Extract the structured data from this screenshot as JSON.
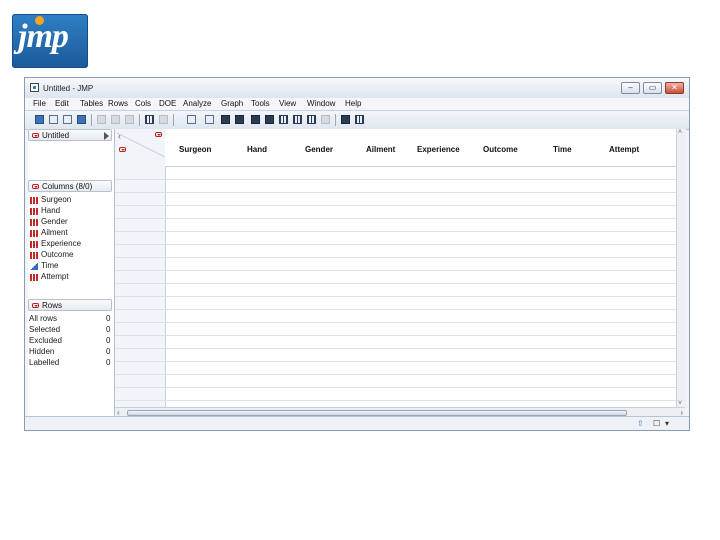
{
  "logo": {
    "text": "jmp"
  },
  "window": {
    "title": "Untitled - JMP",
    "buttons": {
      "minimize": "–",
      "maximize": "▭",
      "close": "✕"
    }
  },
  "menu": [
    "File",
    "Edit",
    "Tables",
    "Rows",
    "Cols",
    "DOE",
    "Analyze",
    "Graph",
    "Tools",
    "View",
    "Window",
    "Help"
  ],
  "table_panel": {
    "name": "Untitled"
  },
  "columns_panel": {
    "header": "Columns (8/0)",
    "items": [
      {
        "label": "Surgeon",
        "icon": "nominal-icon"
      },
      {
        "label": "Hand",
        "icon": "nominal-icon"
      },
      {
        "label": "Gender",
        "icon": "nominal-icon"
      },
      {
        "label": "Ailment",
        "icon": "nominal-icon"
      },
      {
        "label": "Experience",
        "icon": "nominal-icon"
      },
      {
        "label": "Outcome",
        "icon": "nominal-icon"
      },
      {
        "label": "Time",
        "icon": "continuous-icon"
      },
      {
        "label": "Attempt",
        "icon": "nominal-icon"
      }
    ]
  },
  "rows_panel": {
    "header": "Rows",
    "items": [
      {
        "label": "All rows",
        "value": "0"
      },
      {
        "label": "Selected",
        "value": "0"
      },
      {
        "label": "Excluded",
        "value": "0"
      },
      {
        "label": "Hidden",
        "value": "0"
      },
      {
        "label": "Labelled",
        "value": "0"
      }
    ]
  },
  "grid": {
    "columns": [
      "Surgeon",
      "Hand",
      "Gender",
      "Ailment",
      "Experience",
      "Outcome",
      "Time",
      "Attempt"
    ]
  },
  "colors": {
    "accent": "#c62828",
    "chrome": "#dde5ef"
  }
}
